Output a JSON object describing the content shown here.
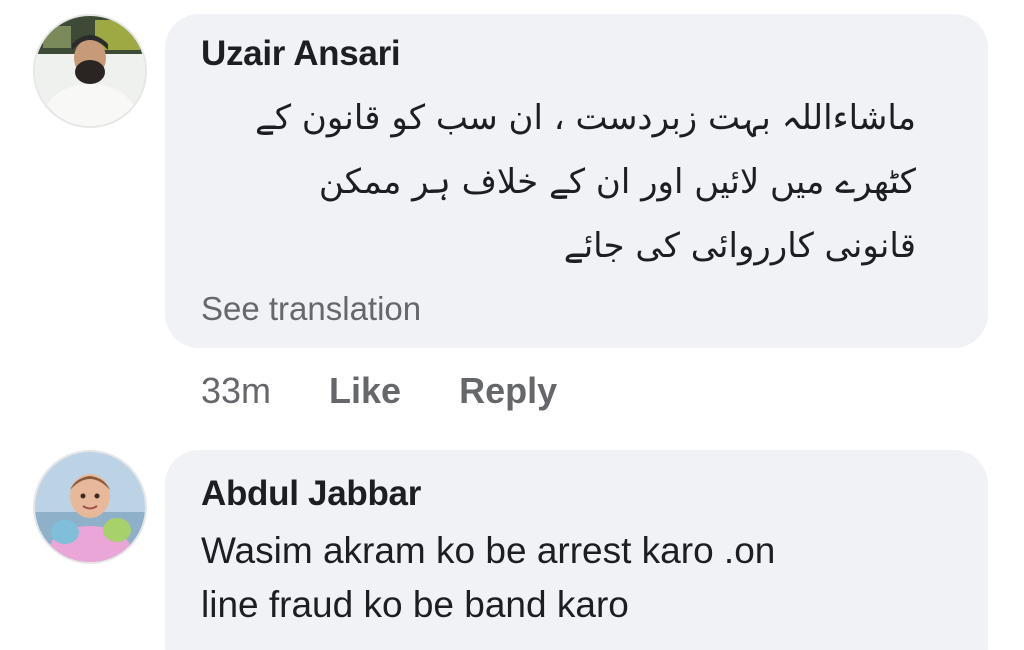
{
  "comments": [
    {
      "author": "Uzair Ansari",
      "text_lines": [
        "ماشاءاللہ بہت زبردست ، ان سب کو قانون کے",
        "کٹھرے میں لائیں اور ان کے خلاف ہر ممکن",
        "قانونی کارروائی کی جائے"
      ],
      "see_translation": "See translation",
      "time": "33m",
      "like_label": "Like",
      "reply_label": "Reply"
    },
    {
      "author": "Abdul Jabbar",
      "text_lines": [
        "Wasim akram ko be arrest karo .on",
        "line fraud ko be band karo"
      ]
    }
  ],
  "colors": {
    "bubble": "#f0f2f5",
    "text_primary": "#1c1e21",
    "text_secondary": "#65676b"
  }
}
